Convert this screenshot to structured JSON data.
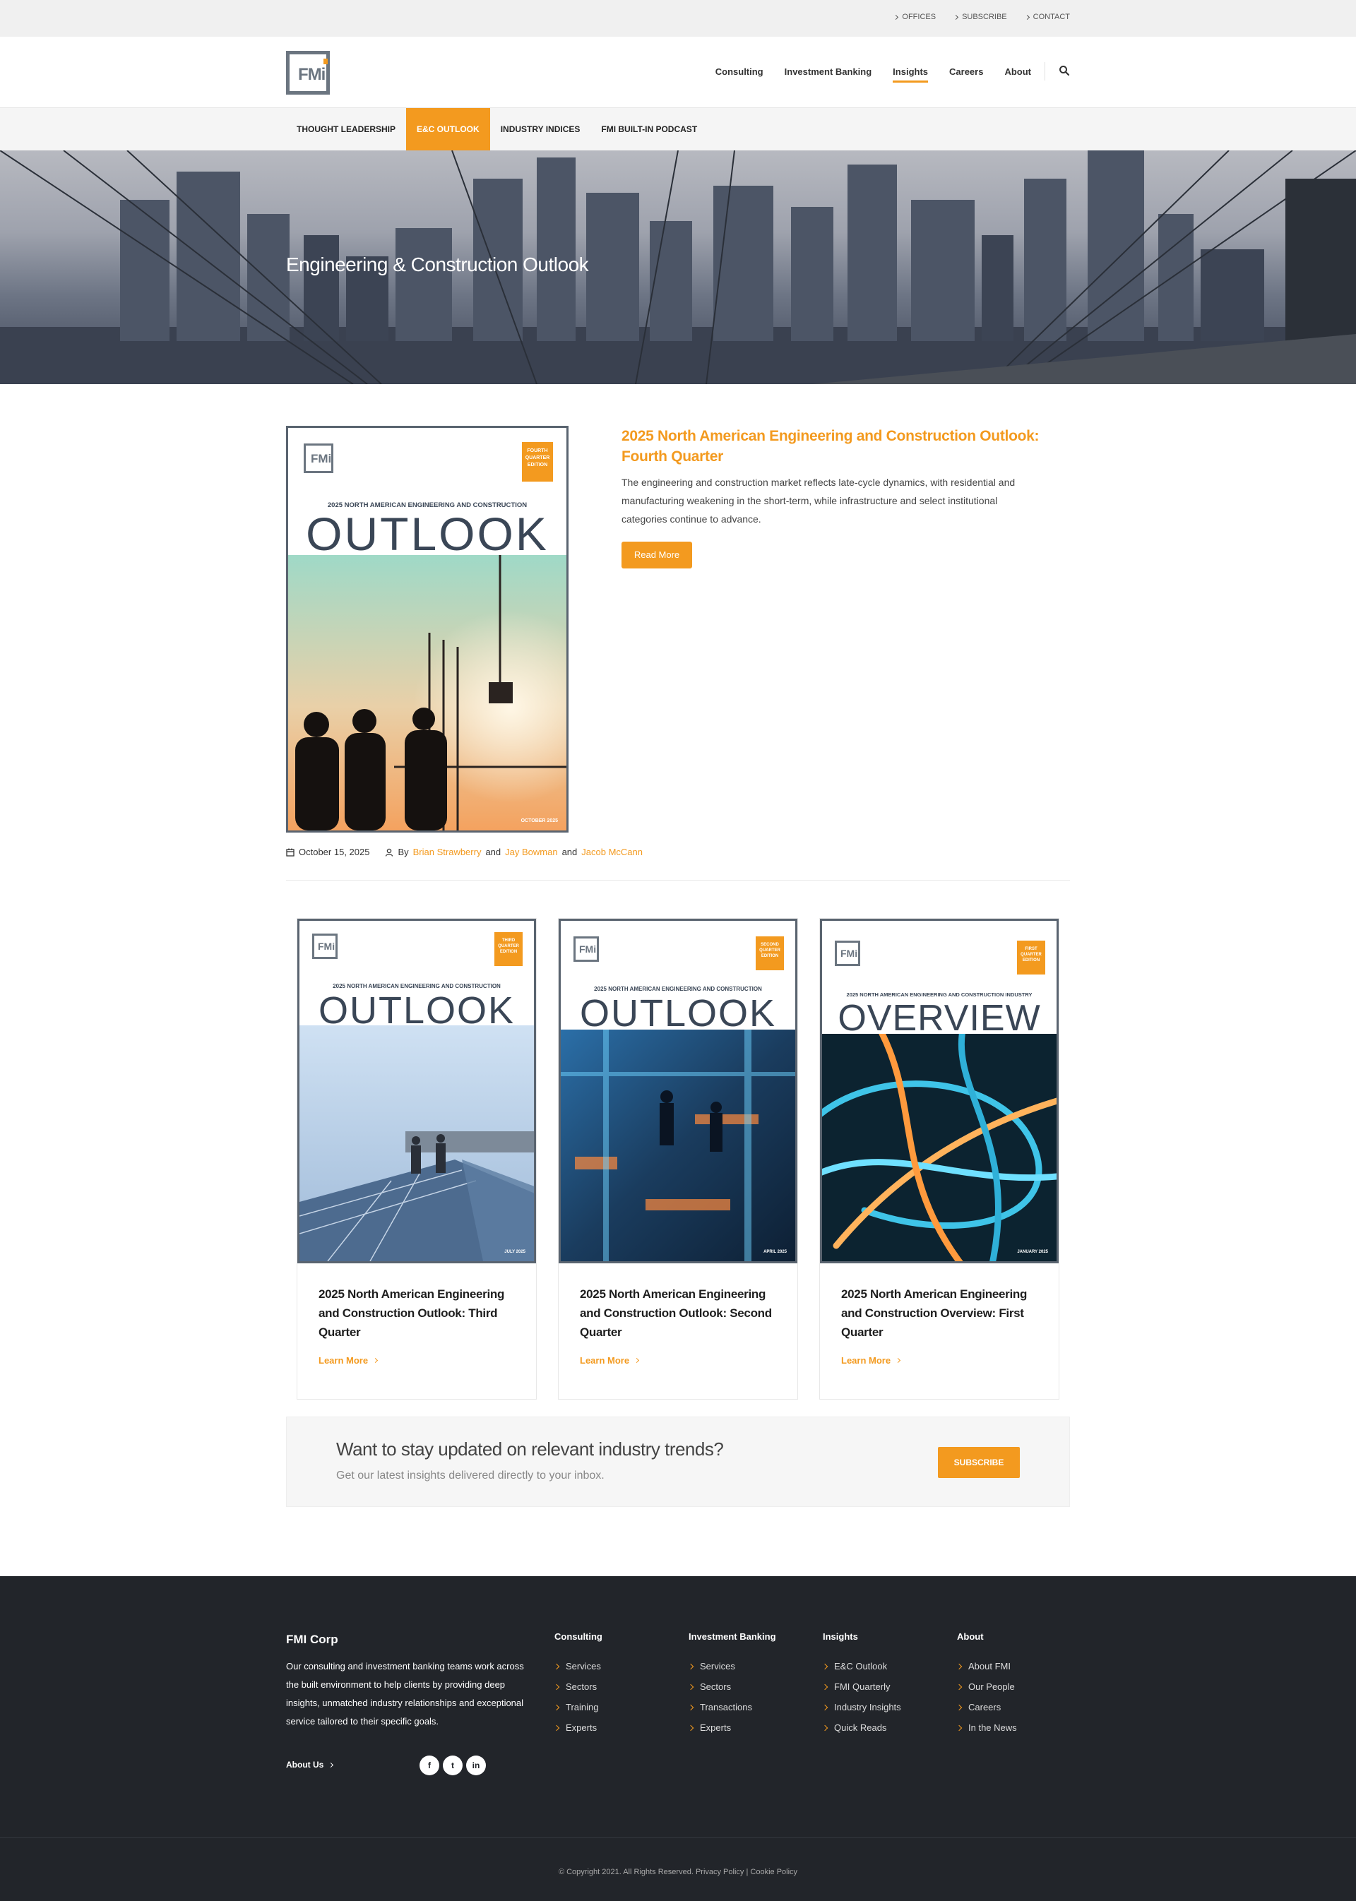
{
  "utility": {
    "links": [
      "OFFICES",
      "SUBSCRIBE",
      "CONTACT"
    ]
  },
  "header": {
    "logo_text": "FMi",
    "nav": [
      "Consulting",
      "Investment Banking",
      "Insights",
      "Careers",
      "About"
    ],
    "active_nav": "Insights"
  },
  "subnav": {
    "items": [
      "THOUGHT LEADERSHIP",
      "E&C OUTLOOK",
      "INDUSTRY INDICES",
      "FMI BUILT-IN PODCAST"
    ],
    "active": "E&C OUTLOOK"
  },
  "hero": {
    "title": "Engineering & Construction Outlook"
  },
  "featured": {
    "cover": {
      "logo": "FMi",
      "badge": "FOURTH QUARTER EDITION",
      "subtitle": "2025 NORTH AMERICAN ENGINEERING AND CONSTRUCTION",
      "big": "OUTLOOK",
      "date": "OCTOBER 2025"
    },
    "title": "2025 North American Engineering and Construction Outlook: Fourth Quarter",
    "text": "The engineering and construction market reflects late-cycle dynamics, with residential and manufacturing weakening in the short-term, while infrastructure and select institutional categories continue to advance.",
    "button": "Read More",
    "date": "October 15, 2025",
    "by": "By",
    "authors": [
      "Brian Strawberry",
      "Jay Bowman",
      "Jacob McCann"
    ],
    "and": "and"
  },
  "cards": [
    {
      "cover": {
        "logo": "FMi",
        "badge": "THIRD QUARTER EDITION",
        "subtitle": "2025 NORTH AMERICAN ENGINEERING AND CONSTRUCTION",
        "big": "OUTLOOK",
        "date": "JULY 2025"
      },
      "title": "2025 North American Engineering and Construction Outlook: Third Quarter",
      "link": "Learn More"
    },
    {
      "cover": {
        "logo": "FMi",
        "badge": "SECOND QUARTER EDITION",
        "subtitle": "2025 NORTH AMERICAN ENGINEERING AND CONSTRUCTION",
        "big": "OUTLOOK",
        "date": "APRIL 2025"
      },
      "title": "2025 North American Engineering and Construction Outlook: Second Quarter",
      "link": "Learn More"
    },
    {
      "cover": {
        "logo": "FMi",
        "badge": "FIRST QUARTER EDITION",
        "subtitle": "2025 NORTH AMERICAN ENGINEERING AND CONSTRUCTION INDUSTRY",
        "big": "OVERVIEW",
        "date": "JANUARY 2025"
      },
      "title": "2025 North American Engineering and Construction Overview: First Quarter",
      "link": "Learn More"
    }
  ],
  "subscribe": {
    "title": "Want to stay updated on relevant industry trends?",
    "subtitle": "Get our latest insights delivered directly to your inbox.",
    "button": "SUBSCRIBE"
  },
  "footer": {
    "brand": "FMI Corp",
    "description": "Our consulting and investment banking teams work across the built environment to help clients by providing deep insights, unmatched industry relationships and exceptional service tailored to their specific goals.",
    "about_link": "About Us",
    "socials": [
      "f",
      "t",
      "in"
    ],
    "columns": [
      {
        "title": "Consulting",
        "items": [
          "Services",
          "Sectors",
          "Training",
          "Experts"
        ]
      },
      {
        "title": "Investment Banking",
        "items": [
          "Services",
          "Sectors",
          "Transactions",
          "Experts"
        ]
      },
      {
        "title": "Insights",
        "items": [
          "E&C Outlook",
          "FMI Quarterly",
          "Industry Insights",
          "Quick Reads"
        ]
      },
      {
        "title": "About",
        "items": [
          "About FMI",
          "Our People",
          "Careers",
          "In the News"
        ]
      }
    ],
    "copyright": "© Copyright 2021. All Rights Reserved.",
    "privacy": "Privacy Policy",
    "separator": "|",
    "cookie": "Cookie Policy"
  },
  "colors": {
    "accent": "#f39a1f",
    "footer_bg": "#22252a",
    "logo_gray": "#6b7580"
  }
}
